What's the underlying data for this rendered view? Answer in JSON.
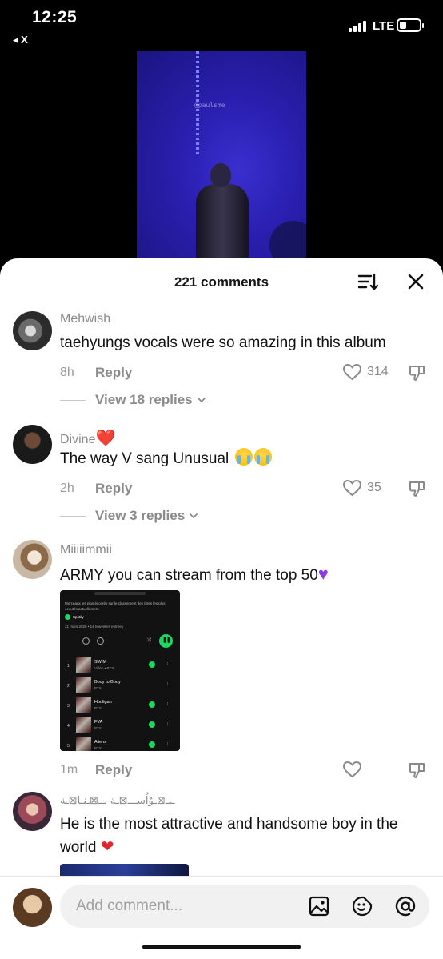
{
  "status_bar": {
    "time": "12:25",
    "back_label": "X",
    "network": "LTE",
    "battery_level": 0.35
  },
  "video": {
    "watermark": "@paulsme"
  },
  "sheet": {
    "title": "221 comments"
  },
  "comments": [
    {
      "username": "Mehwish",
      "text": "taehyungs vocals were so amazing in this album",
      "time": "8h",
      "reply_label": "Reply",
      "likes": "314",
      "view_replies": "View 18 replies"
    },
    {
      "username": "Divine",
      "username_emoji": "❤️",
      "text": "The way V sang Unusual",
      "time": "2h",
      "reply_label": "Reply",
      "likes": "35",
      "view_replies": "View 3 replies"
    },
    {
      "username": "Miiiiimmii",
      "text": "ARMY you can stream from the top 50",
      "time": "1m",
      "reply_label": "Reply",
      "likes": ""
    },
    {
      "username": "ـنـ⊠ـوٌاٌســـ⊠ـة بــ⊠ـنـا⊠ـة",
      "text": "He is the most attractive and handsome boy in the world"
    }
  ],
  "spotify_shot": {
    "header_text": "Morceaux les plus écoutés sur le classement des titres les plus écoutés actuellement.",
    "app_name": "Spotify",
    "date": "21 mars 2026 • 14 nouvelles entrées",
    "tracks": [
      {
        "num": "1",
        "title": "SWIM",
        "artist": "Vidéo • BTS"
      },
      {
        "num": "2",
        "title": "Body to Body",
        "artist": "BTS"
      },
      {
        "num": "3",
        "title": "Hooligan",
        "artist": "BTS"
      },
      {
        "num": "4",
        "title": "FYA",
        "artist": "BTS"
      },
      {
        "num": "5",
        "title": "Aliens",
        "artist": "BTS"
      }
    ]
  },
  "composer": {
    "placeholder": "Add comment..."
  },
  "icons": [
    "sort-icon",
    "close-icon",
    "heart-icon",
    "dislike-icon",
    "chevron-down-icon",
    "image-icon",
    "sticker-icon",
    "mention-icon"
  ]
}
